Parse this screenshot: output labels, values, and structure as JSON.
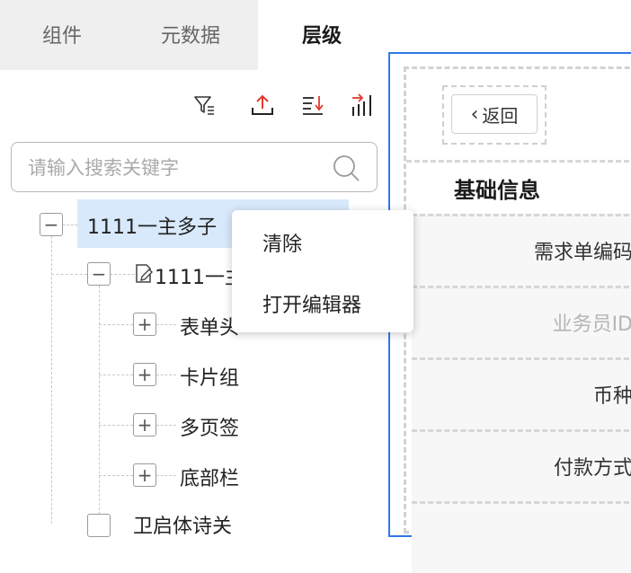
{
  "tabs": [
    "组件",
    "元数据",
    "层级"
  ],
  "toolbar": {
    "icons": [
      "filter-icon",
      "upload-icon",
      "sort-icon",
      "export-icon"
    ]
  },
  "search": {
    "placeholder": "请输入搜索关键字",
    "value": ""
  },
  "tree": {
    "root": {
      "label": "1111一主多子",
      "toggle": "−"
    },
    "child": {
      "label": "1111一主",
      "toggle": "−"
    },
    "items": [
      {
        "label": "表单头",
        "toggle": "+"
      },
      {
        "label": "卡片组",
        "toggle": "+"
      },
      {
        "label": "多页签",
        "toggle": "+"
      },
      {
        "label": "底部栏",
        "toggle": "+"
      }
    ],
    "partial_label": "卫启体诗关"
  },
  "context_menu": {
    "items": [
      "清除",
      "打开编辑器"
    ]
  },
  "right_panel": {
    "back_label": "返回",
    "section_title": "基础信息",
    "fields": [
      {
        "label": "需求单编码",
        "muted": false
      },
      {
        "label": "业务员ID",
        "muted": true
      },
      {
        "label": "币种",
        "muted": false
      },
      {
        "label": "付款方式",
        "muted": false
      }
    ]
  },
  "colors": {
    "accent": "#2f78e8",
    "selection": "#d8e9fb",
    "export_red": "#e03a2f"
  }
}
